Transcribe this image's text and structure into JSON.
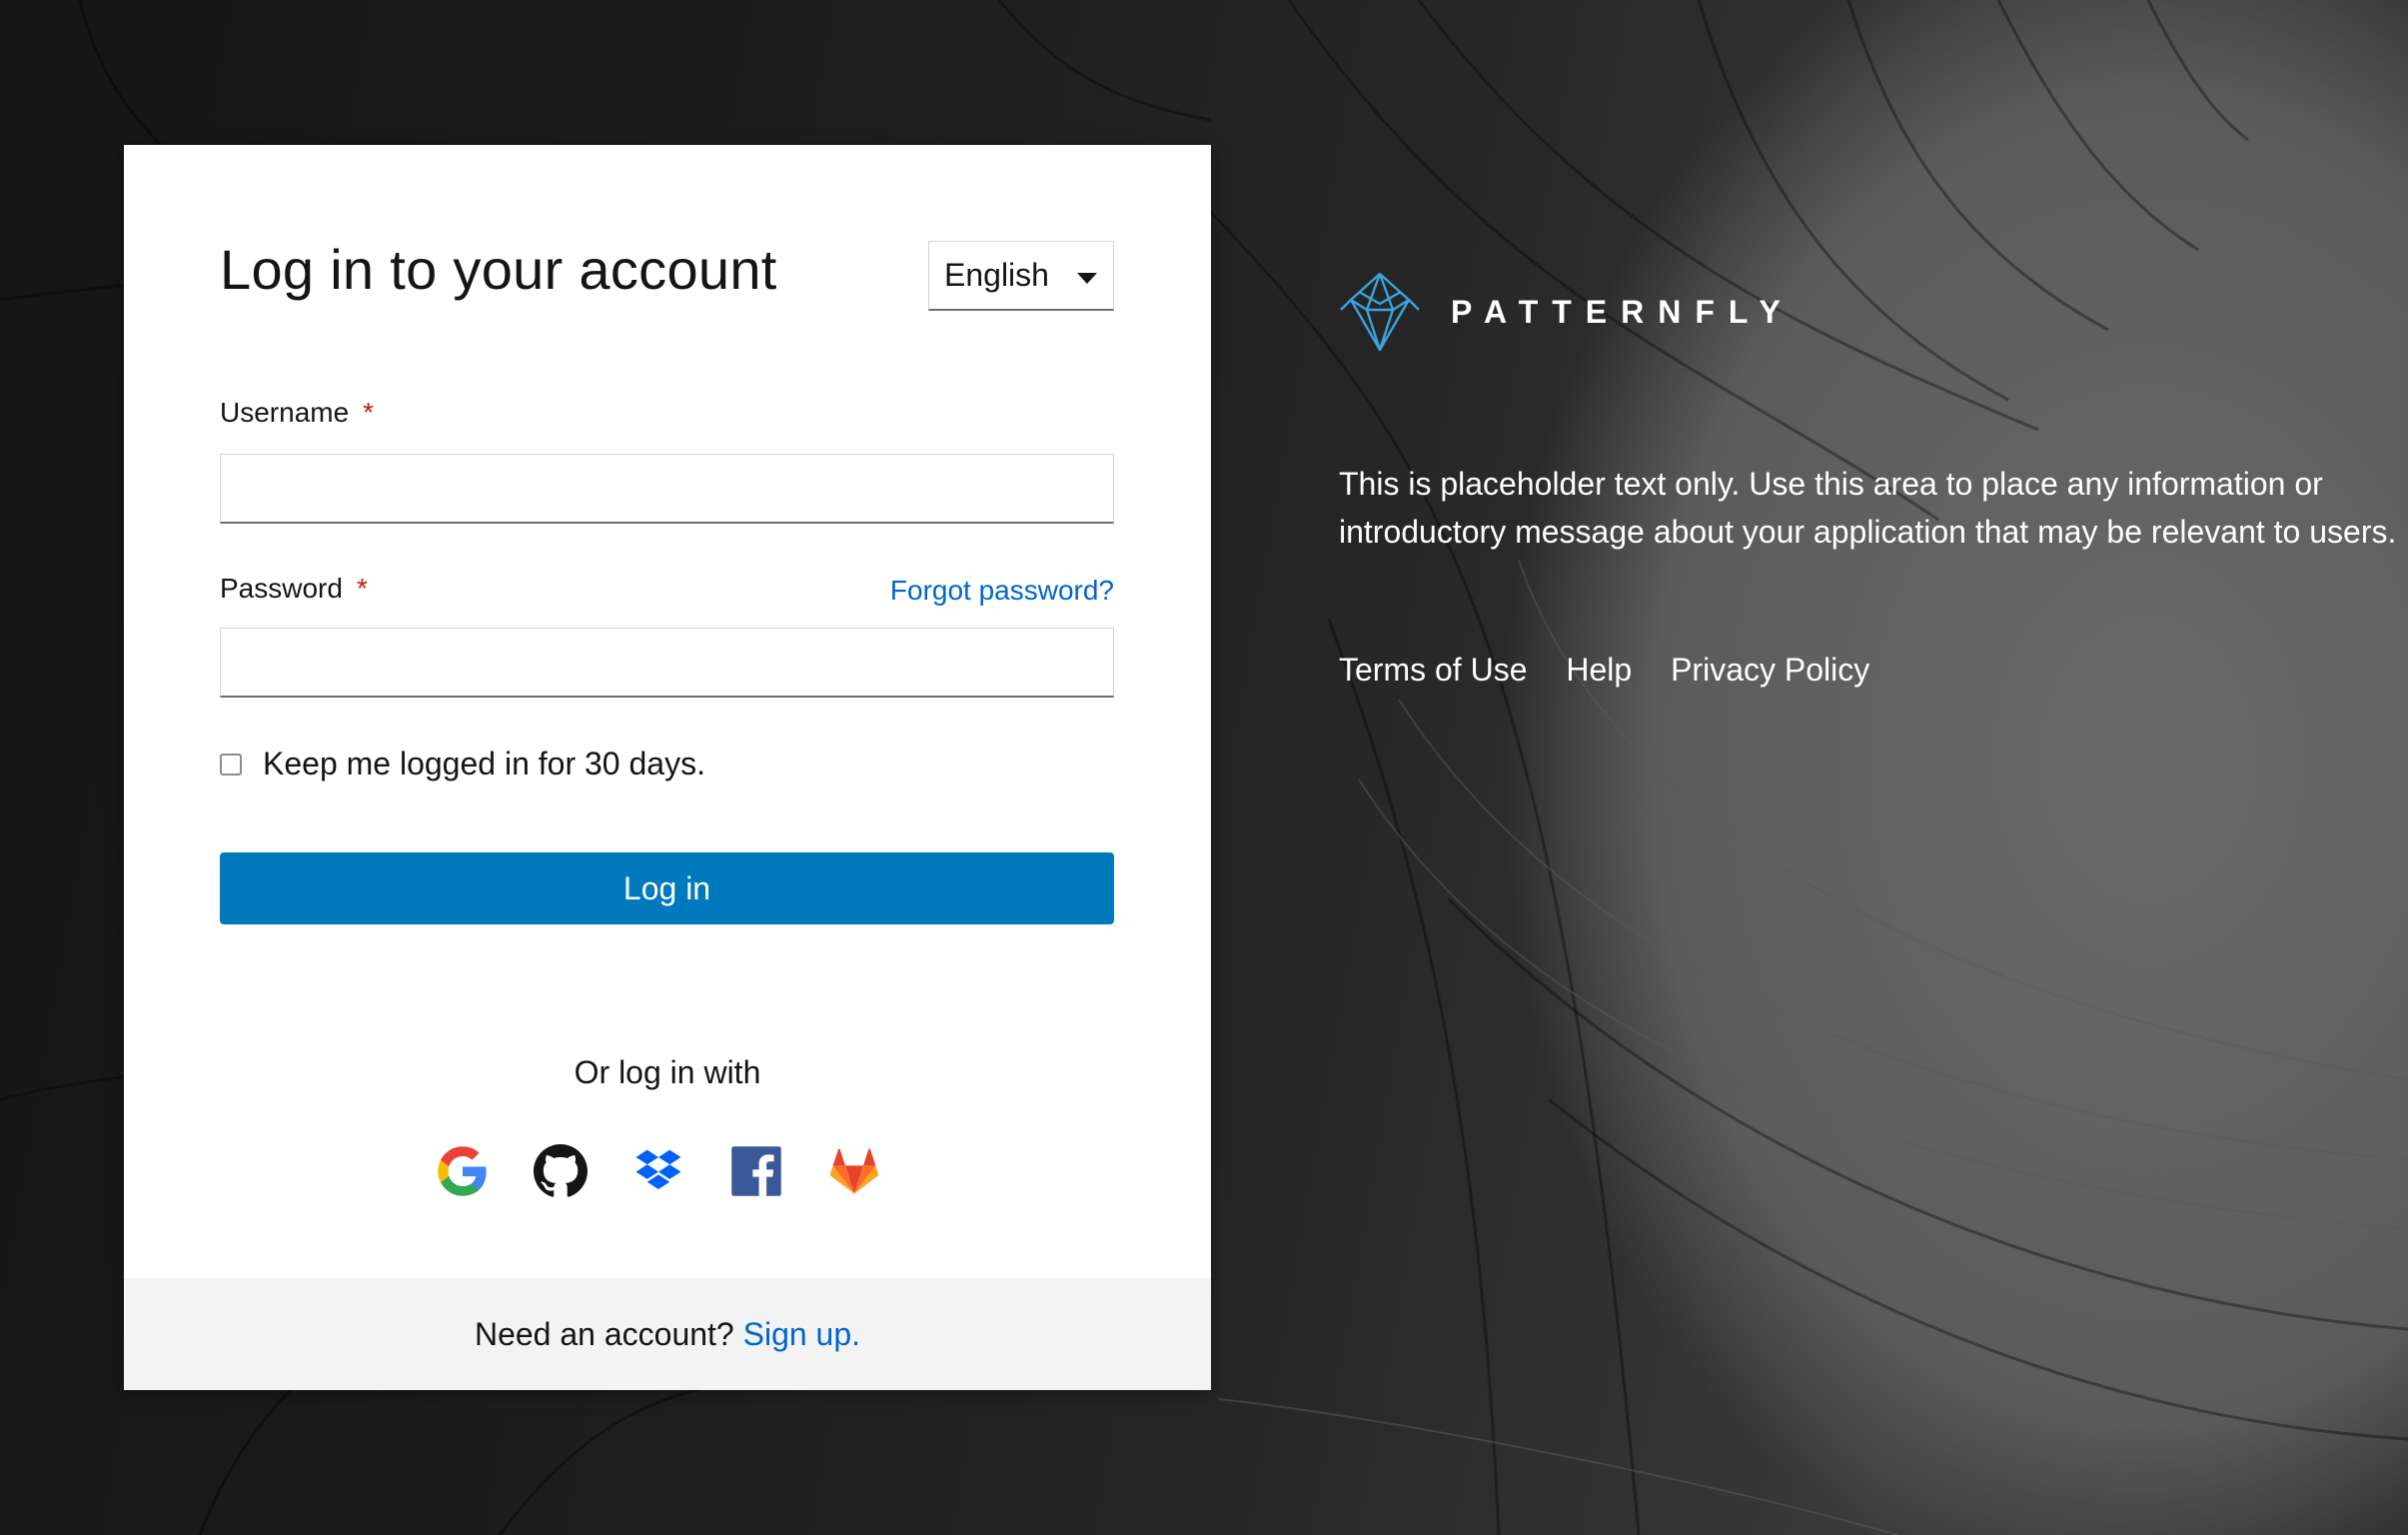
{
  "login": {
    "title": "Log in to your account",
    "language": "English",
    "username_label": "Username",
    "password_label": "Password",
    "required_marker": "*",
    "forgot_password": "Forgot password?",
    "remember_label": "Keep me logged in for 30 days.",
    "login_button": "Log in",
    "or_login_with": "Or log in with",
    "social": [
      "google-icon",
      "github-icon",
      "dropbox-icon",
      "facebook-icon",
      "gitlab-icon"
    ],
    "footer_text": "Need an account?",
    "signup_link": "Sign up."
  },
  "brand": {
    "name": "PATTERNFLY",
    "accent_color": "#39a5dc"
  },
  "info": {
    "text": "This is placeholder text only. Use this area to place any information or introductory message about your application that may be relevant to users."
  },
  "footer_links": [
    "Terms of Use",
    "Help",
    "Privacy Policy"
  ],
  "colors": {
    "primary": "#0079bd",
    "link": "#0066cc",
    "required": "#c9190b"
  }
}
